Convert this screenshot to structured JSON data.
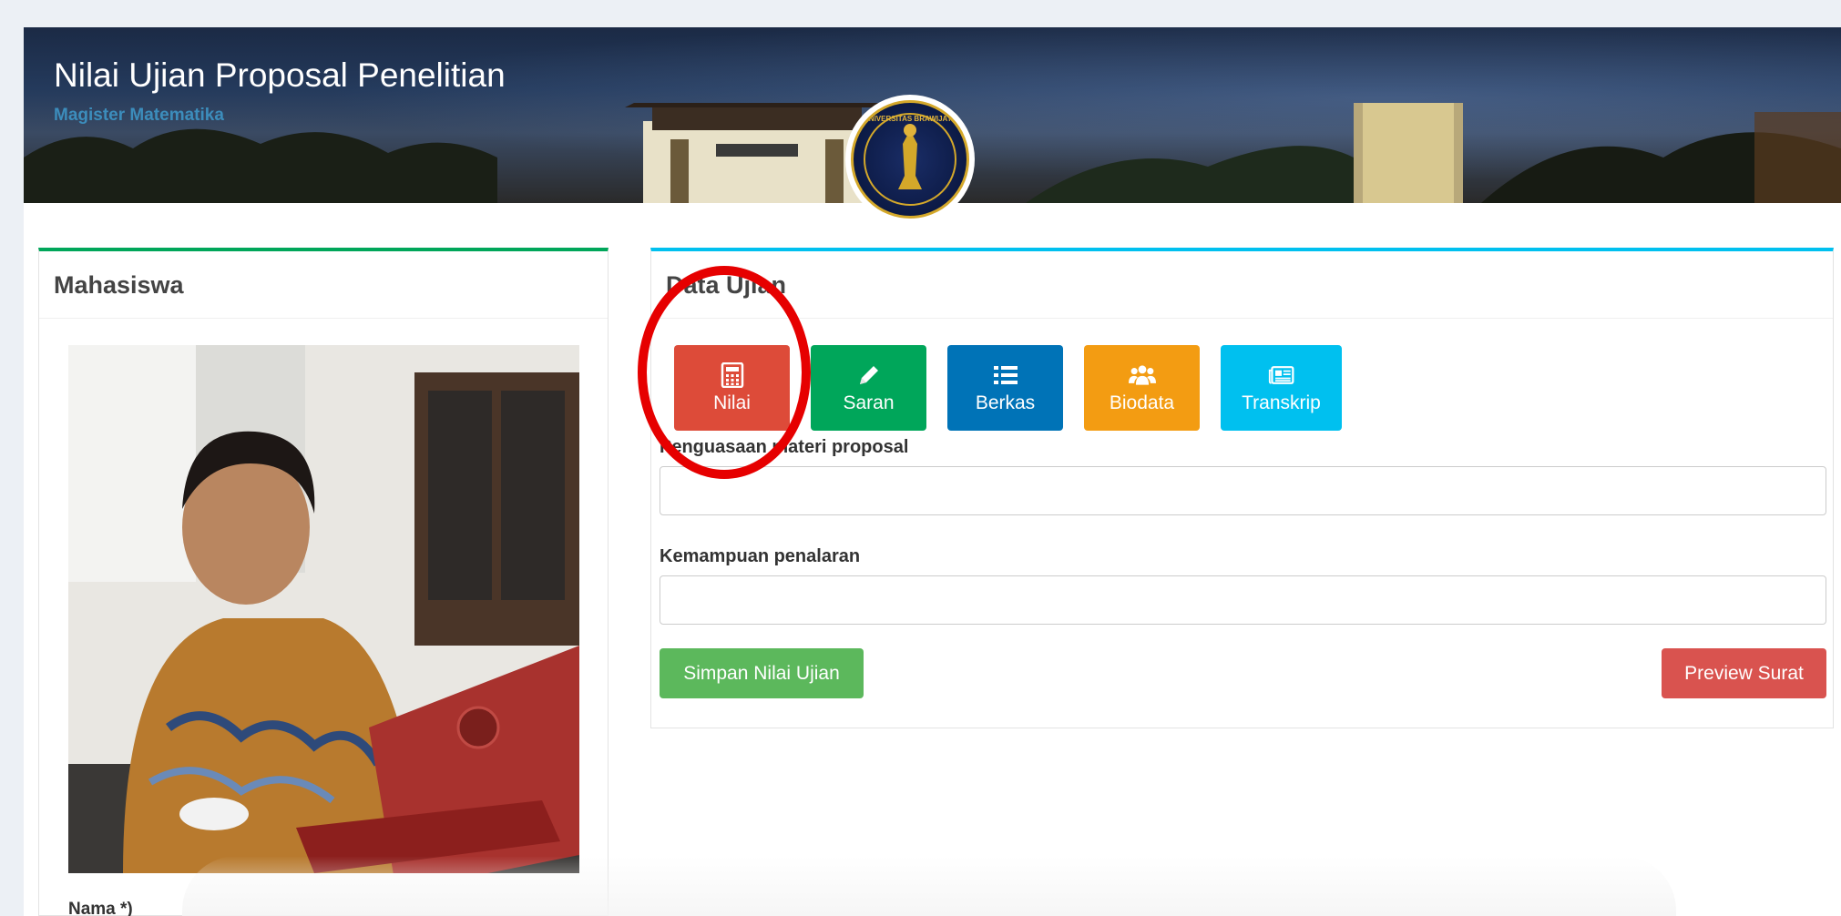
{
  "banner": {
    "title": "Nilai Ujian Proposal Penelitian",
    "subtitle": "Magister Matematika",
    "logo_text": "UNIVERSITAS BRAWIJAYA"
  },
  "left_panel": {
    "title": "Mahasiswa",
    "nama_label": "Nama *)"
  },
  "right_panel": {
    "title": "Data Ujian",
    "tiles": [
      {
        "label": "Nilai",
        "icon": "calculator-icon",
        "color": "#dd4b39"
      },
      {
        "label": "Saran",
        "icon": "pencil-icon",
        "color": "#00a65a"
      },
      {
        "label": "Berkas",
        "icon": "list-icon",
        "color": "#0073b7"
      },
      {
        "label": "Biodata",
        "icon": "users-icon",
        "color": "#f39c12"
      },
      {
        "label": "Transkrip",
        "icon": "newspaper-icon",
        "color": "#00c0ef"
      }
    ],
    "fields": [
      {
        "label": "Penguasaan materi proposal",
        "value": ""
      },
      {
        "label": "Kemampuan penalaran",
        "value": ""
      }
    ],
    "save_button": "Simpan Nilai Ujian",
    "preview_button": "Preview Surat"
  },
  "colors": {
    "highlight": "#e60000",
    "accent_green": "#00a65a",
    "accent_cyan": "#00c0ef"
  }
}
